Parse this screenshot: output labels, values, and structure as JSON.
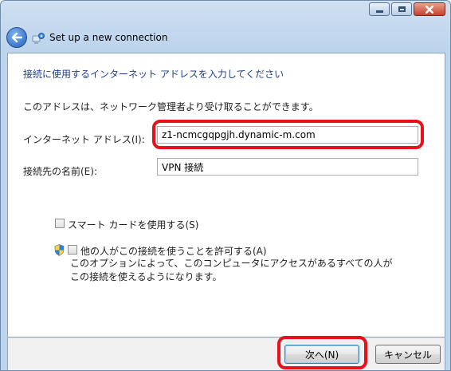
{
  "window": {
    "title": "Set up a new connection",
    "controls": {
      "minimize": "minimize-icon",
      "maximize": "maximize-icon",
      "close": "close-icon"
    }
  },
  "nav": {
    "back_icon": "back-arrow-icon",
    "wizard_icon": "network-connection-icon"
  },
  "content": {
    "heading": "接続に使用するインターネット アドレスを入力してください",
    "description": "このアドレスは、ネットワーク管理者より受け取ることができます。",
    "address_label": "インターネット アドレス(I):",
    "address_value": "z1-ncmcgqpgjh.dynamic-m.com",
    "name_label": "接続先の名前(E):",
    "name_value": "VPN 接続",
    "smartcard_label": "スマート カードを使用する(S)",
    "smartcard_checked": false,
    "allow_others_label": "他の人がこの接続を使うことを許可する(A)",
    "allow_others_checked": false,
    "allow_others_help_line1": "このオプションによって、このコンピュータにアクセスがあるすべての人が",
    "allow_others_help_line2": "この接続を使えるようになります。"
  },
  "footer": {
    "next_label": "次へ(N)",
    "cancel_label": "キャンセル"
  },
  "colors": {
    "heading": "#1e3e8f",
    "highlight": "#e8101a",
    "chrome": "#bcd4ec"
  }
}
